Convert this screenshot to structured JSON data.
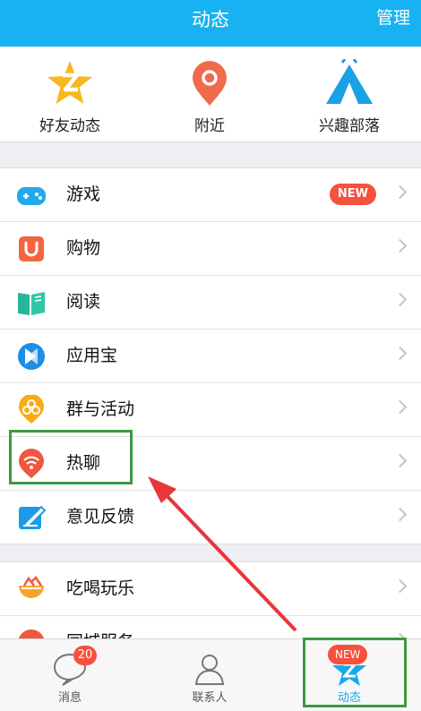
{
  "header": {
    "title": "动态",
    "manage": "管理"
  },
  "quick": [
    {
      "label": "好友动态",
      "icon": "star-icon"
    },
    {
      "label": "附近",
      "icon": "location-pin-icon"
    },
    {
      "label": "兴趣部落",
      "icon": "tent-icon"
    }
  ],
  "list1": [
    {
      "label": "游戏",
      "icon": "gamepad-icon",
      "badge": "NEW"
    },
    {
      "label": "购物",
      "icon": "shopping-icon"
    },
    {
      "label": "阅读",
      "icon": "book-icon"
    },
    {
      "label": "应用宝",
      "icon": "app-store-icon"
    },
    {
      "label": "群与活动",
      "icon": "group-icon"
    },
    {
      "label": "热聊",
      "icon": "hot-chat-icon"
    },
    {
      "label": "意见反馈",
      "icon": "feedback-icon"
    }
  ],
  "list2": [
    {
      "label": "吃喝玩乐",
      "icon": "food-fun-icon"
    },
    {
      "label": "同城服务",
      "icon": "local-service-icon"
    }
  ],
  "tabs": [
    {
      "label": "消息",
      "badge": "20",
      "icon": "message-icon"
    },
    {
      "label": "联系人",
      "icon": "contacts-icon"
    },
    {
      "label": "动态",
      "badge": "NEW",
      "icon": "star-tab-icon"
    }
  ],
  "colors": {
    "accent": "#16b2f1",
    "badge": "#f5513c",
    "highlight": "#3c9a3f",
    "arrow": "#e8363a"
  }
}
